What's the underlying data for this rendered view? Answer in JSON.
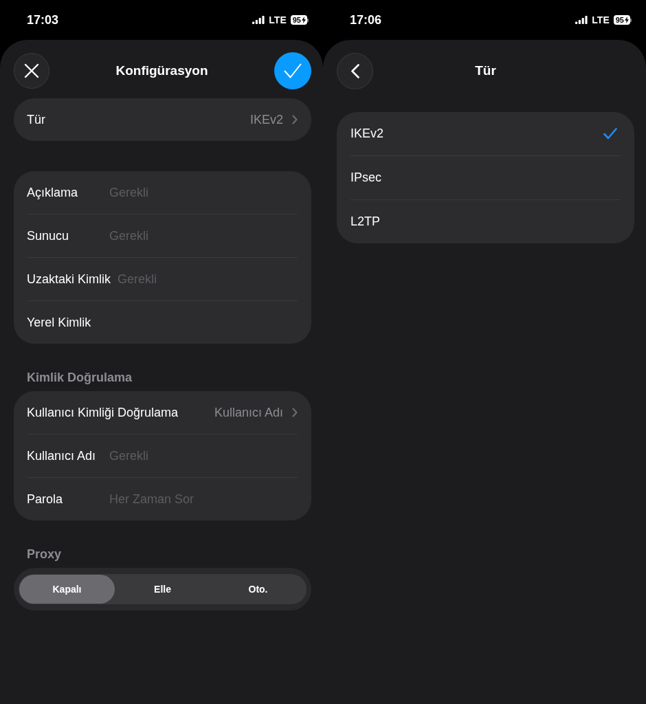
{
  "configuration_screen": {
    "status_bar": {
      "time": "17:03",
      "network": "LTE",
      "battery": "95"
    },
    "nav": {
      "title": "Konfigürasyon",
      "close_button": true,
      "confirm_button": true
    },
    "sections": [
      {
        "kind": "list",
        "rows": [
          {
            "kind": "disclosure",
            "label": "Tür",
            "value": "IKEv2"
          }
        ]
      },
      {
        "kind": "list",
        "rows": [
          {
            "kind": "field",
            "label": "Açıklama",
            "placeholder": "Gerekli"
          },
          {
            "kind": "field",
            "label": "Sunucu",
            "placeholder": "Gerekli"
          },
          {
            "kind": "field",
            "label": "Uzaktaki Kimlik",
            "placeholder": "Gerekli"
          },
          {
            "kind": "field",
            "label": "Yerel Kimlik"
          }
        ]
      },
      {
        "kind": "list",
        "title": "Kimlik Doğrulama",
        "rows": [
          {
            "kind": "disclosure",
            "label": "Kullanıcı Kimliği Doğrulama",
            "value": "Kullanıcı Adı"
          },
          {
            "kind": "field",
            "label": "Kullanıcı Adı",
            "placeholder": "Gerekli"
          },
          {
            "kind": "field",
            "label": "Parola",
            "placeholder": "Her Zaman Sor"
          }
        ]
      },
      {
        "kind": "segmented",
        "title": "Proxy",
        "segments": [
          {
            "label": "Kapalı",
            "selected": true
          },
          {
            "label": "Elle",
            "selected": false
          },
          {
            "label": "Oto.",
            "selected": false
          }
        ]
      }
    ]
  },
  "type_screen": {
    "status_bar": {
      "time": "17:06",
      "network": "LTE",
      "battery": "95"
    },
    "nav": {
      "title": "Tür",
      "back_button": true
    },
    "options": [
      {
        "label": "IKEv2",
        "selected": true
      },
      {
        "label": "IPsec",
        "selected": false
      },
      {
        "label": "L2TP",
        "selected": false
      }
    ]
  }
}
